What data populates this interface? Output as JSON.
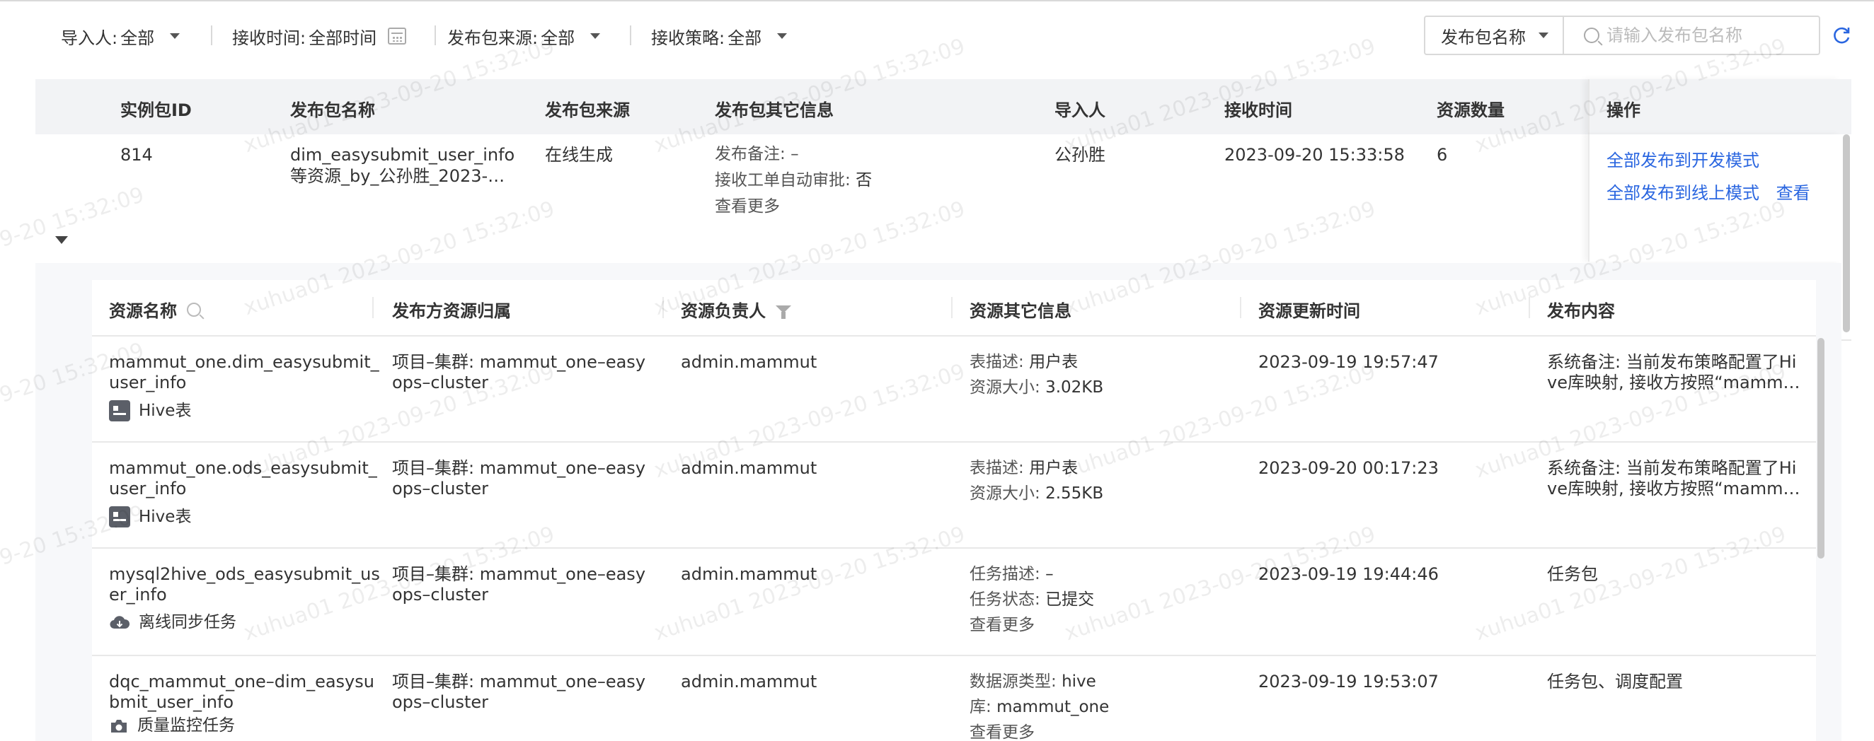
{
  "filters": {
    "importer": {
      "label": "导入人:",
      "value": "全部"
    },
    "receive_time": {
      "label": "接收时间:",
      "value": "全部时间"
    },
    "source": {
      "label": "发布包来源:",
      "value": "全部"
    },
    "strategy": {
      "label": "接收策略:",
      "value": "全部"
    },
    "search_field": "发布包名称",
    "search_placeholder": "请输入发布包名称"
  },
  "outer_table": {
    "columns": {
      "id": "实例包ID",
      "name": "发布包名称",
      "source": "发布包来源",
      "other_info": "发布包其它信息",
      "importer": "导入人",
      "receive_time": "接收时间",
      "resource_count": "资源数量",
      "actions": "操作"
    },
    "row": {
      "id": "814",
      "name_line1": "dim_easysubmit_user_info",
      "name_line2": "等资源_by_公孙胜_2023-…",
      "source": "在线生成",
      "remark_label": "发布备注:",
      "remark_value": "–",
      "auto_approve_label": "接收工单自动审批:",
      "auto_approve_value": "否",
      "more_link": "查看更多",
      "importer": "公孙胜",
      "receive_time": "2023-09-20 15:33:58",
      "resource_count": "6",
      "action_dev": "全部发布到开发模式",
      "action_online": "全部发布到线上模式",
      "action_view": "查看"
    }
  },
  "inner_table": {
    "columns": {
      "resource_name": "资源名称",
      "owner_scope": "发布方资源归属",
      "owner": "资源负责人",
      "other_info": "资源其它信息",
      "update_time": "资源更新时间",
      "content": "发布内容"
    },
    "rows": [
      {
        "name_line1": "mammut_one.dim_easysubmit_",
        "name_line2": "user_info",
        "type": "Hive表",
        "type_icon": "hive-table-icon",
        "scope_line1": "项目–集群: mammut_one–easy",
        "scope_line2": "ops–cluster",
        "owner": "admin.mammut",
        "info1_label": "表描述:",
        "info1_value": "用户表",
        "info2_label": "资源大小:",
        "info2_value": "3.02KB",
        "more": "",
        "update_time": "2023-09-19 19:57:47",
        "content_line1": "系统备注: 当前发布策略配置了Hi",
        "content_line2": "ve库映射, 接收方按照“mamm…"
      },
      {
        "name_line1": "mammut_one.ods_easysubmit_",
        "name_line2": "user_info",
        "type": "Hive表",
        "type_icon": "hive-table-icon",
        "scope_line1": "项目–集群: mammut_one–easy",
        "scope_line2": "ops–cluster",
        "owner": "admin.mammut",
        "info1_label": "表描述:",
        "info1_value": "用户表",
        "info2_label": "资源大小:",
        "info2_value": "2.55KB",
        "more": "",
        "update_time": "2023-09-20 00:17:23",
        "content_line1": "系统备注: 当前发布策略配置了Hi",
        "content_line2": "ve库映射, 接收方按照“mamm…"
      },
      {
        "name_line1": "mysql2hive_ods_easysubmit_us",
        "name_line2": "er_info",
        "type": "离线同步任务",
        "type_icon": "cloud-sync-icon",
        "scope_line1": "项目–集群: mammut_one–easy",
        "scope_line2": "ops–cluster",
        "owner": "admin.mammut",
        "info1_label": "任务描述:",
        "info1_value": "–",
        "info2_label": "任务状态:",
        "info2_value": "已提交",
        "more": "查看更多",
        "update_time": "2023-09-19 19:44:46",
        "content_line1": "任务包",
        "content_line2": ""
      },
      {
        "name_line1": "dqc_mammut_one–dim_easysu",
        "name_line2": "bmit_user_info",
        "type": "质量监控任务",
        "type_icon": "camera-monitor-icon",
        "scope_line1": "项目–集群: mammut_one–easy",
        "scope_line2": "ops–cluster",
        "owner": "admin.mammut",
        "info1_label": "数据源类型:",
        "info1_value": "hive",
        "info2_label": "库:",
        "info2_value": "mammut_one",
        "more": "查看更多",
        "update_time": "2023-09-19 19:53:07",
        "content_line1": "任务包、调度配置",
        "content_line2": ""
      }
    ]
  },
  "watermark": "xuhua01 2023-09-20 15:32:09",
  "colors": {
    "link": "#2a66e0",
    "header_bg": "#f2f3f5"
  }
}
